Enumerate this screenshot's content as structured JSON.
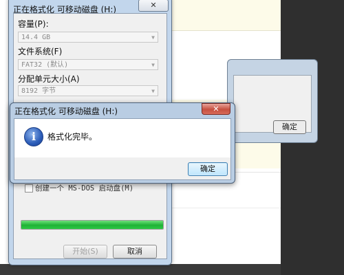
{
  "format_window": {
    "title": "正在格式化 可移动磁盘 (H:)",
    "close_glyph": "✕",
    "capacity_label": "容量(P):",
    "capacity_value": "14.4 GB",
    "filesystem_label": "文件系统(F)",
    "filesystem_value": "FAT32 (默认)",
    "alloc_label": "分配单元大小(A)",
    "alloc_value": "8192 字节",
    "msdos_label": "创建一个 MS-DOS 启动盘(M)",
    "progress_fraction": 1.0,
    "start_button": "开始(S)",
    "cancel_button": "取消"
  },
  "message_box": {
    "title": "正在格式化 可移动磁盘 (H:)",
    "close_glyph": "✕",
    "icon": "info-icon",
    "icon_glyph": "i",
    "message": "格式化完毕。",
    "ok_button": "确定"
  },
  "background_dialog": {
    "button_label": "确定"
  },
  "colors": {
    "progress": "#1fb236",
    "title_bar": "#c2d6ec",
    "close_red": "#c6503f"
  }
}
